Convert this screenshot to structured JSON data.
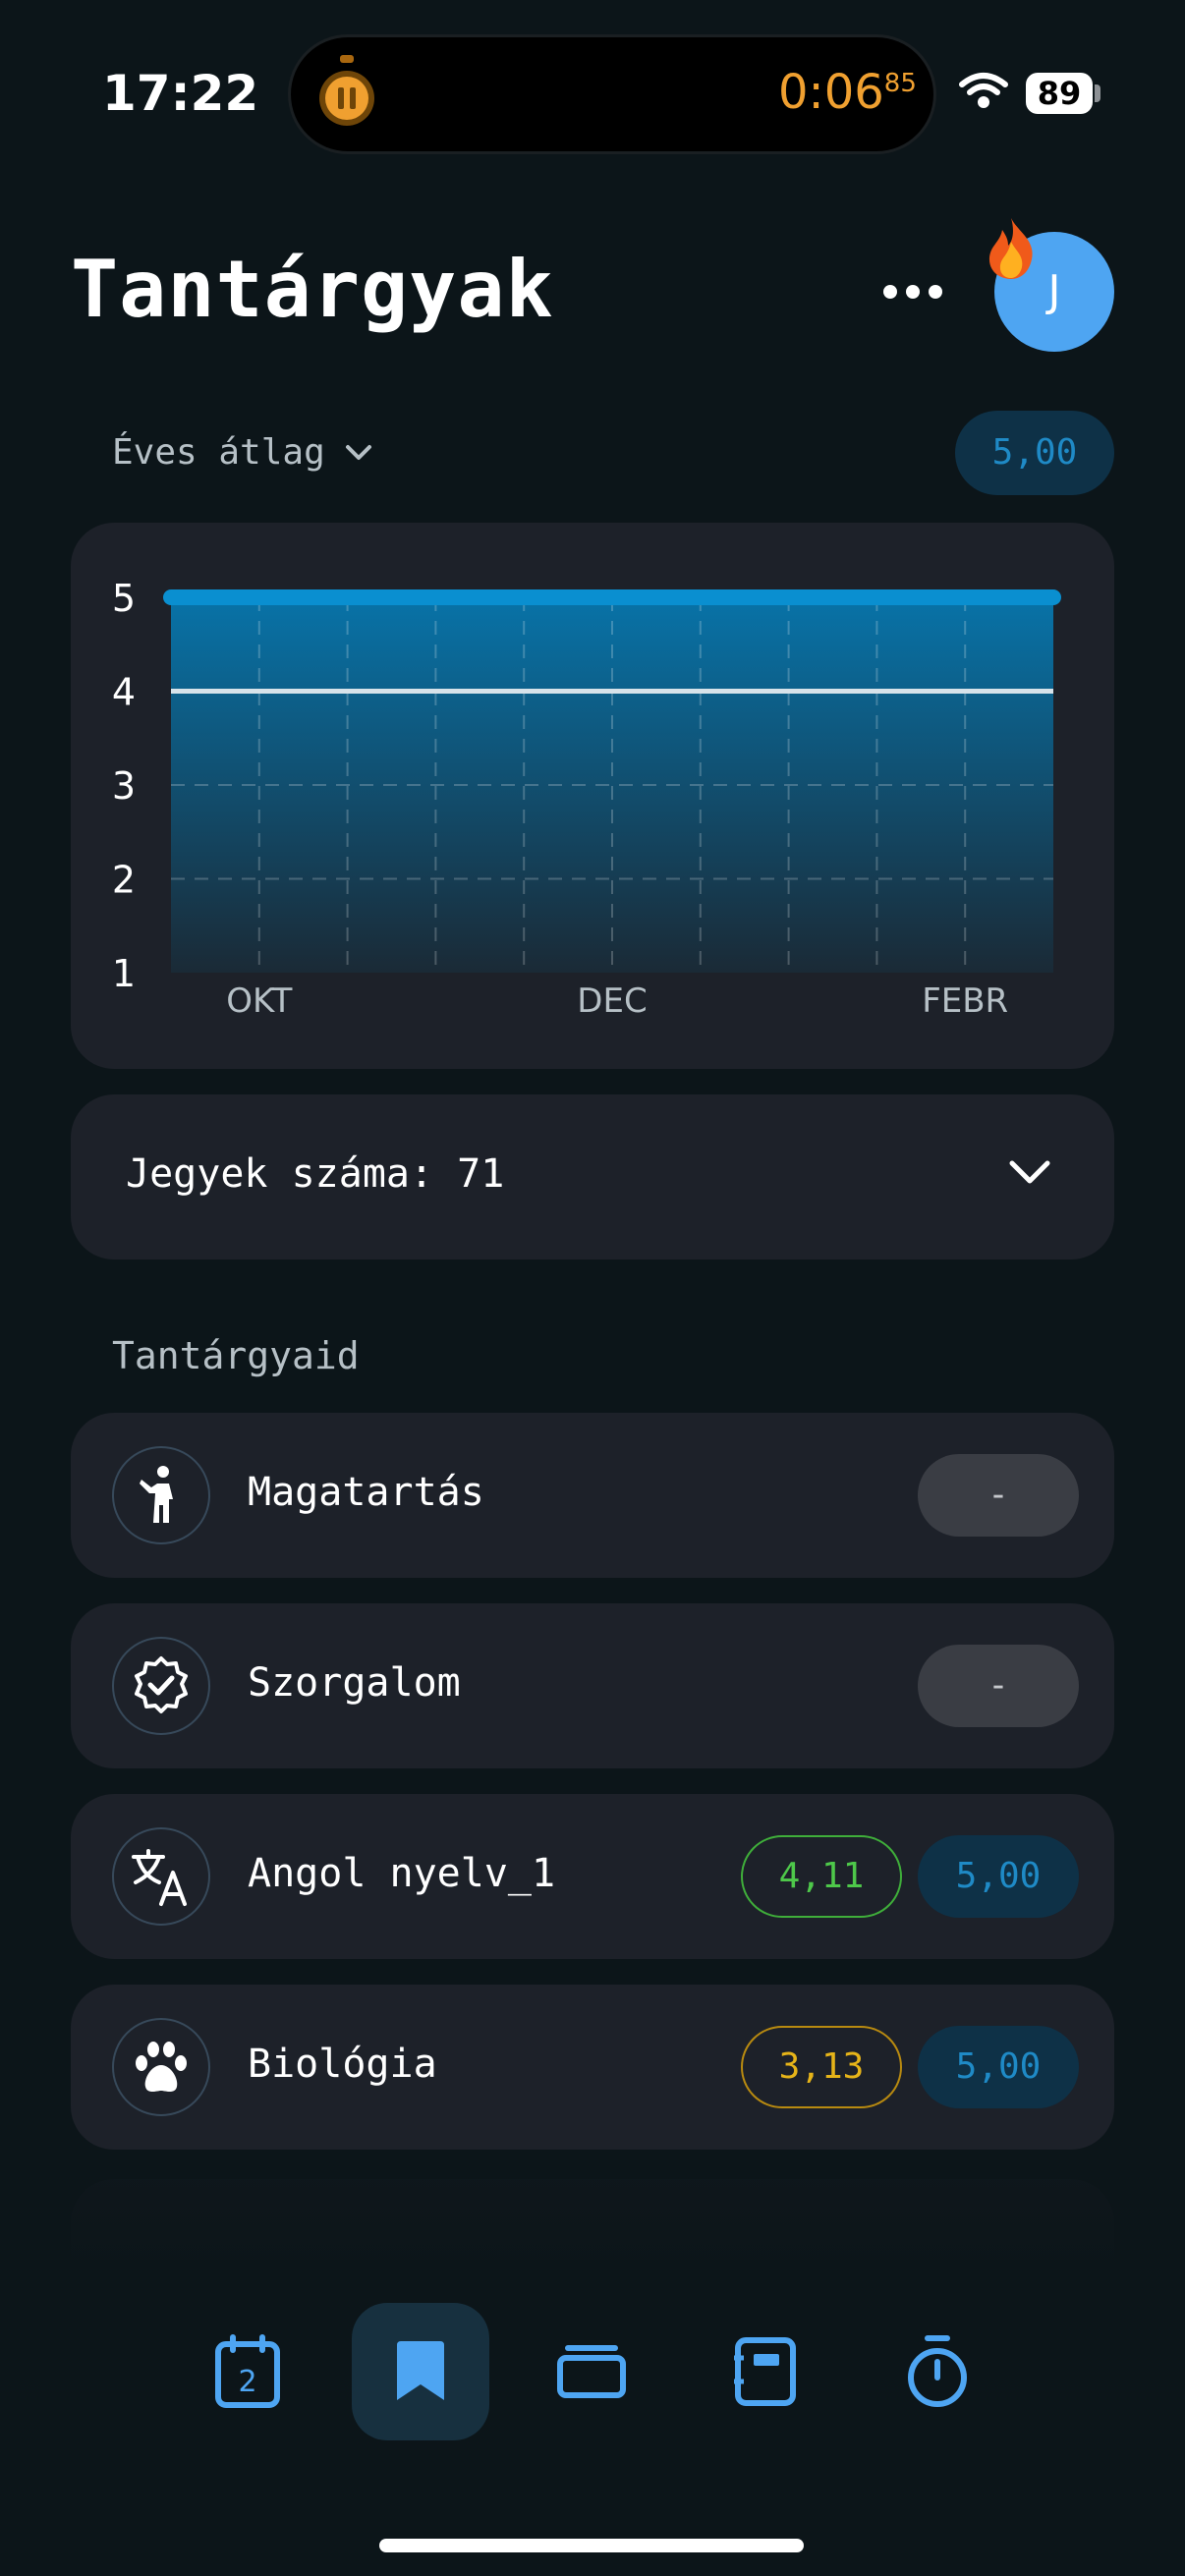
{
  "status_bar": {
    "time": "17:22",
    "live_timer": {
      "main": "0:06",
      "fraction": "85"
    },
    "battery": "89"
  },
  "header": {
    "title": "Tantárgyak",
    "avatar_initial": "J"
  },
  "average": {
    "label": "Éves átlag",
    "value": "5,00"
  },
  "chart_data": {
    "type": "area",
    "y_ticks": [
      "5",
      "4",
      "3",
      "2",
      "1"
    ],
    "x_ticks": [
      "OKT",
      "DEC",
      "FEBR"
    ],
    "ylim": [
      1,
      5
    ],
    "series": [
      {
        "values": [
          5,
          5,
          5,
          5,
          5,
          5,
          5,
          5,
          5,
          5,
          5
        ],
        "color": "#0a8fd0"
      },
      {
        "values": [
          4,
          4,
          4,
          4,
          4,
          4,
          4,
          4,
          4,
          4,
          4
        ],
        "color": "#d7e3ea"
      }
    ],
    "grid": true
  },
  "grades": {
    "text": "Jegyek száma: 71"
  },
  "subjects_section": "Tantárgyaid",
  "subjects": [
    {
      "name": "Magatartás",
      "icon": "person-icon",
      "value": "-"
    },
    {
      "name": "Szorgalom",
      "icon": "verified-badge-icon",
      "value": "-"
    },
    {
      "name": "Angol nyelv_1",
      "icon": "translate-icon",
      "class_avg": "4,11",
      "value": "5,00",
      "class_avg_color": "#4ec84a"
    },
    {
      "name": "Biológia",
      "icon": "paw-icon",
      "class_avg": "3,13",
      "value": "5,00",
      "class_avg_color": "#e6b419"
    }
  ],
  "tabbar": {
    "items": [
      {
        "icon": "calendar-icon",
        "badge": "2"
      },
      {
        "icon": "bookmark-icon",
        "active": true
      },
      {
        "icon": "cards-icon"
      },
      {
        "icon": "notebook-icon"
      },
      {
        "icon": "stopwatch-icon"
      }
    ]
  },
  "colors": {
    "accent": "#4ea5f2",
    "background": "#0c1519",
    "card": "#1d2129"
  }
}
